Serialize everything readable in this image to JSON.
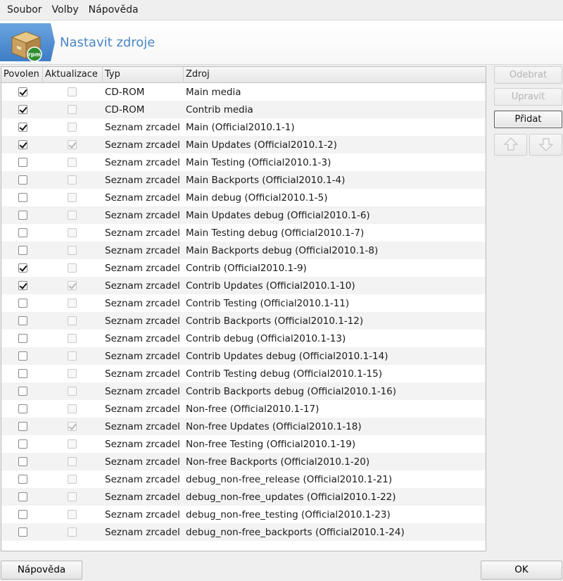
{
  "menu": [
    "Soubor",
    "Volby",
    "Nápověda"
  ],
  "banner": {
    "title": "Nastavit zdroje",
    "icon": "rpm-package-icon"
  },
  "columns": {
    "enabled": "Povolen",
    "update": "Aktualizace",
    "type": "Typ",
    "source": "Zdroj"
  },
  "rows": [
    {
      "enabled": true,
      "update": false,
      "type": "CD-ROM",
      "source": "Main media"
    },
    {
      "enabled": true,
      "update": false,
      "type": "CD-ROM",
      "source": "Contrib media"
    },
    {
      "enabled": true,
      "update": false,
      "type": "Seznam zrcadel",
      "source": "Main (Official2010.1-1)"
    },
    {
      "enabled": true,
      "update": true,
      "type": "Seznam zrcadel",
      "source": "Main Updates (Official2010.1-2)"
    },
    {
      "enabled": false,
      "update": false,
      "type": "Seznam zrcadel",
      "source": "Main Testing (Official2010.1-3)"
    },
    {
      "enabled": false,
      "update": false,
      "type": "Seznam zrcadel",
      "source": "Main Backports (Official2010.1-4)"
    },
    {
      "enabled": false,
      "update": false,
      "type": "Seznam zrcadel",
      "source": "Main debug (Official2010.1-5)"
    },
    {
      "enabled": false,
      "update": false,
      "type": "Seznam zrcadel",
      "source": "Main Updates debug (Official2010.1-6)"
    },
    {
      "enabled": false,
      "update": false,
      "type": "Seznam zrcadel",
      "source": "Main Testing debug (Official2010.1-7)"
    },
    {
      "enabled": false,
      "update": false,
      "type": "Seznam zrcadel",
      "source": "Main Backports debug (Official2010.1-8)"
    },
    {
      "enabled": true,
      "update": false,
      "type": "Seznam zrcadel",
      "source": "Contrib (Official2010.1-9)"
    },
    {
      "enabled": true,
      "update": true,
      "type": "Seznam zrcadel",
      "source": "Contrib Updates (Official2010.1-10)"
    },
    {
      "enabled": false,
      "update": false,
      "type": "Seznam zrcadel",
      "source": "Contrib Testing (Official2010.1-11)"
    },
    {
      "enabled": false,
      "update": false,
      "type": "Seznam zrcadel",
      "source": "Contrib Backports (Official2010.1-12)"
    },
    {
      "enabled": false,
      "update": false,
      "type": "Seznam zrcadel",
      "source": "Contrib debug (Official2010.1-13)"
    },
    {
      "enabled": false,
      "update": false,
      "type": "Seznam zrcadel",
      "source": "Contrib Updates debug (Official2010.1-14)"
    },
    {
      "enabled": false,
      "update": false,
      "type": "Seznam zrcadel",
      "source": "Contrib Testing debug (Official2010.1-15)"
    },
    {
      "enabled": false,
      "update": false,
      "type": "Seznam zrcadel",
      "source": "Contrib Backports debug (Official2010.1-16)"
    },
    {
      "enabled": false,
      "update": false,
      "type": "Seznam zrcadel",
      "source": "Non-free (Official2010.1-17)"
    },
    {
      "enabled": false,
      "update": true,
      "type": "Seznam zrcadel",
      "source": "Non-free Updates (Official2010.1-18)"
    },
    {
      "enabled": false,
      "update": false,
      "type": "Seznam zrcadel",
      "source": "Non-free Testing (Official2010.1-19)"
    },
    {
      "enabled": false,
      "update": false,
      "type": "Seznam zrcadel",
      "source": "Non-free Backports (Official2010.1-20)"
    },
    {
      "enabled": false,
      "update": false,
      "type": "Seznam zrcadel",
      "source": "debug_non-free_release (Official2010.1-21)"
    },
    {
      "enabled": false,
      "update": false,
      "type": "Seznam zrcadel",
      "source": "debug_non-free_updates (Official2010.1-22)"
    },
    {
      "enabled": false,
      "update": false,
      "type": "Seznam zrcadel",
      "source": "debug_non-free_testing (Official2010.1-23)"
    },
    {
      "enabled": false,
      "update": false,
      "type": "Seznam zrcadel",
      "source": "debug_non-free_backports (Official2010.1-24)"
    }
  ],
  "side_buttons": {
    "remove": "Odebrat",
    "edit": "Upravit",
    "add": "Přidat",
    "up_icon": "arrow-up-icon",
    "down_icon": "arrow-down-icon"
  },
  "bottom_buttons": {
    "help": "Nápověda",
    "ok": "OK"
  },
  "colors": {
    "accent": "#4a86c6",
    "banner_blue": "#3e7cc6"
  }
}
